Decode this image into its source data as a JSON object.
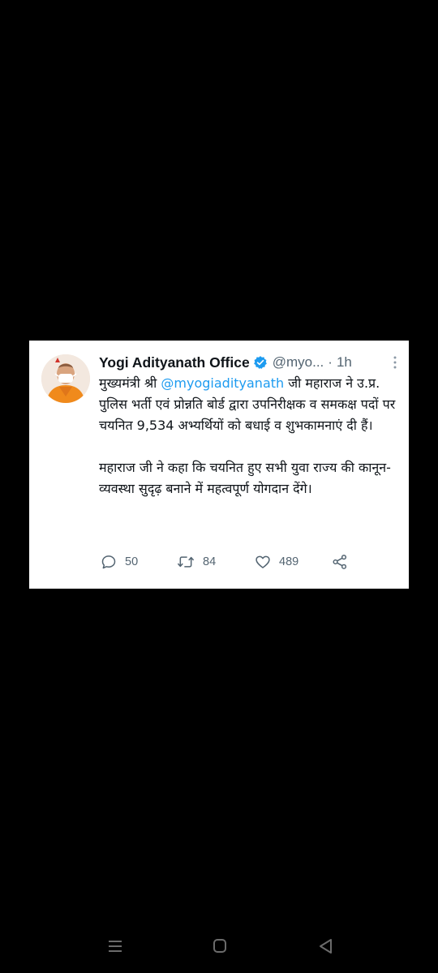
{
  "tweet": {
    "author_name": "Yogi Adityanath Office",
    "handle": "@myo...",
    "separator": "·",
    "time": "1h",
    "text": {
      "p1_before": "मुख्यमंत्री श्री ",
      "mention": "@myogiadityanath",
      "p1_after": " जी महाराज ने उ.प्र. पुलिस भर्ती एवं प्रोन्नति बोर्ड द्वारा उपनिरीक्षक व समकक्ष पदों पर चयनित 9,534 अभ्यर्थियों को बधाई व शुभकामनाएं दी हैं।",
      "p2": "महाराज जी ने कहा कि चयनित हुए सभी युवा राज्य की कानून-व्यवस्था सुदृढ़ बनाने में महत्वपूर्ण योगदान देंगे।"
    },
    "actions": {
      "replies": "50",
      "retweets": "84",
      "likes": "489"
    },
    "icons": {
      "verified": "verified-badge-icon",
      "more": "more-vertical-icon",
      "reply": "reply-icon",
      "retweet": "retweet-icon",
      "like": "heart-icon",
      "share": "share-icon"
    },
    "colors": {
      "verified": "#1d9bf0",
      "mention": "#1d9bf0",
      "secondary_text": "#536471",
      "primary_text": "#0f1419"
    }
  },
  "navigation_bar": {
    "icons": [
      "menu-icon",
      "home-icon",
      "back-icon"
    ]
  }
}
